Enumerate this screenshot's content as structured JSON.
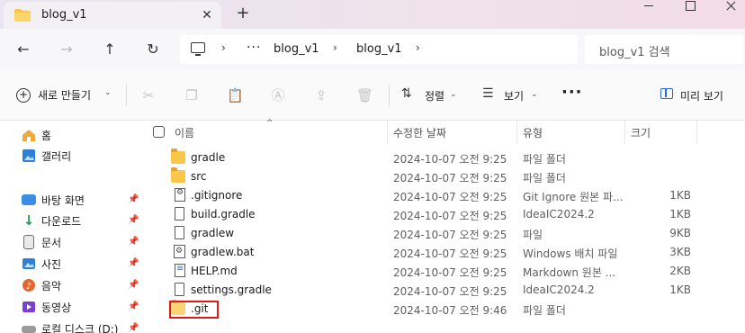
{
  "titlebar": {
    "tab_title": "blog_v1",
    "new_tab_symbol": "+"
  },
  "nav": {
    "breadcrumb": [
      "blog_v1",
      "blog_v1"
    ],
    "overflow": "···",
    "search_placeholder": "blog_v1 검색"
  },
  "command_bar": {
    "new_label": "새로 만들기",
    "sort_label": "정렬",
    "view_label": "보기",
    "details_label": "미리 보기",
    "more": "···"
  },
  "sidebar": {
    "top_items": [
      {
        "label": "홈",
        "icon": "home-icon"
      },
      {
        "label": "갤러리",
        "icon": "gallery-icon"
      }
    ],
    "quick_access": [
      {
        "label": "바탕 화면",
        "icon": "desktop-icon",
        "color": "#3a8ee6"
      },
      {
        "label": "다운로드",
        "icon": "download-icon",
        "color": "#1f9d55"
      },
      {
        "label": "문서",
        "icon": "documents-icon",
        "color": "#6b6b6b"
      },
      {
        "label": "사진",
        "icon": "pictures-icon",
        "color": "#2f7fd8"
      },
      {
        "label": "음악",
        "icon": "music-icon",
        "color": "#e6672e"
      },
      {
        "label": "동영상",
        "icon": "videos-icon",
        "color": "#7a3fd1"
      },
      {
        "label": "로컬 디스크 (D:)",
        "icon": "drive-icon",
        "color": "#888888"
      }
    ]
  },
  "columns": {
    "name": "이름",
    "modified": "수정한 날짜",
    "type": "유형",
    "size": "크기"
  },
  "files": [
    {
      "name": "gradle",
      "icon": "folder",
      "modified": "2024-10-07 오전 9:25",
      "type": "파일 폴더",
      "size": ""
    },
    {
      "name": "src",
      "icon": "folder",
      "modified": "2024-10-07 오전 9:25",
      "type": "파일 폴더",
      "size": ""
    },
    {
      "name": ".gitignore",
      "icon": "gear",
      "modified": "2024-10-07 오전 9:25",
      "type": "Git Ignore 원본 파...",
      "size": "1KB"
    },
    {
      "name": "build.gradle",
      "icon": "doc",
      "modified": "2024-10-07 오전 9:25",
      "type": "IdeaIC2024.2",
      "size": "1KB"
    },
    {
      "name": "gradlew",
      "icon": "doc",
      "modified": "2024-10-07 오전 9:25",
      "type": "파일",
      "size": "9KB"
    },
    {
      "name": "gradlew.bat",
      "icon": "bat",
      "modified": "2024-10-07 오전 9:25",
      "type": "Windows 배치 파일",
      "size": "3KB"
    },
    {
      "name": "HELP.md",
      "icon": "md",
      "modified": "2024-10-07 오전 9:25",
      "type": "Markdown 원본 ...",
      "size": "2KB"
    },
    {
      "name": "settings.gradle",
      "icon": "doc",
      "modified": "2024-10-07 오전 9:25",
      "type": "IdeaIC2024.2",
      "size": "1KB"
    },
    {
      "name": ".git",
      "icon": "folder",
      "modified": "2024-10-07 오전 9:46",
      "type": "파일 폴더",
      "size": ""
    }
  ],
  "colors": {
    "highlight": "#e11919",
    "accent": "#2a6ad6",
    "folder": "#f7c64a"
  }
}
